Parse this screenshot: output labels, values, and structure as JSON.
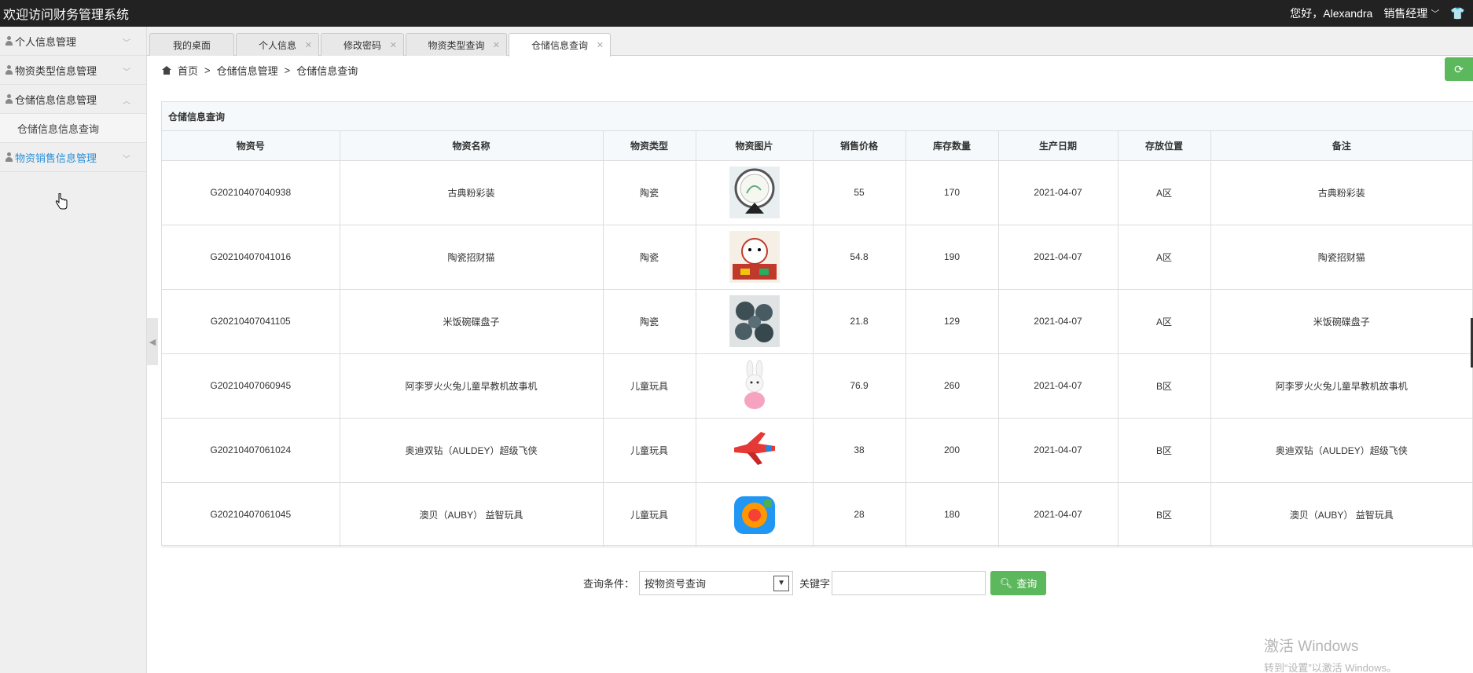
{
  "app": {
    "title": "欢迎访问财务管理系统",
    "greeting": "您好，Alexandra",
    "role": "销售经理"
  },
  "sidebar": {
    "items": [
      {
        "label": "个人信息管理"
      },
      {
        "label": "物资类型信息管理"
      },
      {
        "label": "仓储信息信息管理",
        "sub": [
          "仓储信息信息查询"
        ]
      },
      {
        "label": "物资销售信息管理"
      }
    ]
  },
  "tabs": [
    {
      "label": "我的桌面"
    },
    {
      "label": "个人信息"
    },
    {
      "label": "修改密码"
    },
    {
      "label": "物资类型查询"
    },
    {
      "label": "仓储信息查询"
    }
  ],
  "breadcrumb": {
    "home": "首页",
    "sep": ">",
    "level1": "仓储信息管理",
    "level2": "仓储信息查询"
  },
  "panel": {
    "title": "仓储信息查询"
  },
  "table": {
    "headers": [
      "物资号",
      "物资名称",
      "物资类型",
      "物资图片",
      "销售价格",
      "库存数量",
      "生产日期",
      "存放位置",
      "备注"
    ],
    "rows": [
      {
        "id": "G20210407040938",
        "name": "古典粉彩装",
        "type": "陶瓷",
        "price": "55",
        "stock": "170",
        "date": "2021-04-07",
        "loc": "A区",
        "note": "古典粉彩装"
      },
      {
        "id": "G20210407041016",
        "name": "陶瓷招财猫",
        "type": "陶瓷",
        "price": "54.8",
        "stock": "190",
        "date": "2021-04-07",
        "loc": "A区",
        "note": "陶瓷招财猫"
      },
      {
        "id": "G20210407041105",
        "name": "米饭碗碟盘子",
        "type": "陶瓷",
        "price": "21.8",
        "stock": "129",
        "date": "2021-04-07",
        "loc": "A区",
        "note": "米饭碗碟盘子"
      },
      {
        "id": "G20210407060945",
        "name": "阿李罗火火兔儿童早教机故事机",
        "type": "儿童玩具",
        "price": "76.9",
        "stock": "260",
        "date": "2021-04-07",
        "loc": "B区",
        "note": "阿李罗火火兔儿童早教机故事机"
      },
      {
        "id": "G20210407061024",
        "name": "奥迪双钻（AULDEY）超级飞侠",
        "type": "儿童玩具",
        "price": "38",
        "stock": "200",
        "date": "2021-04-07",
        "loc": "B区",
        "note": "奥迪双钻（AULDEY）超级飞侠"
      },
      {
        "id": "G20210407061045",
        "name": "澳贝（AUBY） 益智玩具",
        "type": "儿童玩具",
        "price": "28",
        "stock": "180",
        "date": "2021-04-07",
        "loc": "B区",
        "note": "澳贝（AUBY） 益智玩具"
      }
    ]
  },
  "search": {
    "condition_label": "查询条件：",
    "selected": "按物资号查询",
    "keyword_label": "关键字",
    "keyword_value": "",
    "button": "查询"
  },
  "watermark": {
    "line1": "激活 Windows",
    "line2": "转到“设置”以激活 Windows。"
  },
  "colors": {
    "topbar": "#222222",
    "accent": "#5cb85c",
    "active_link": "#2a8fd6"
  }
}
